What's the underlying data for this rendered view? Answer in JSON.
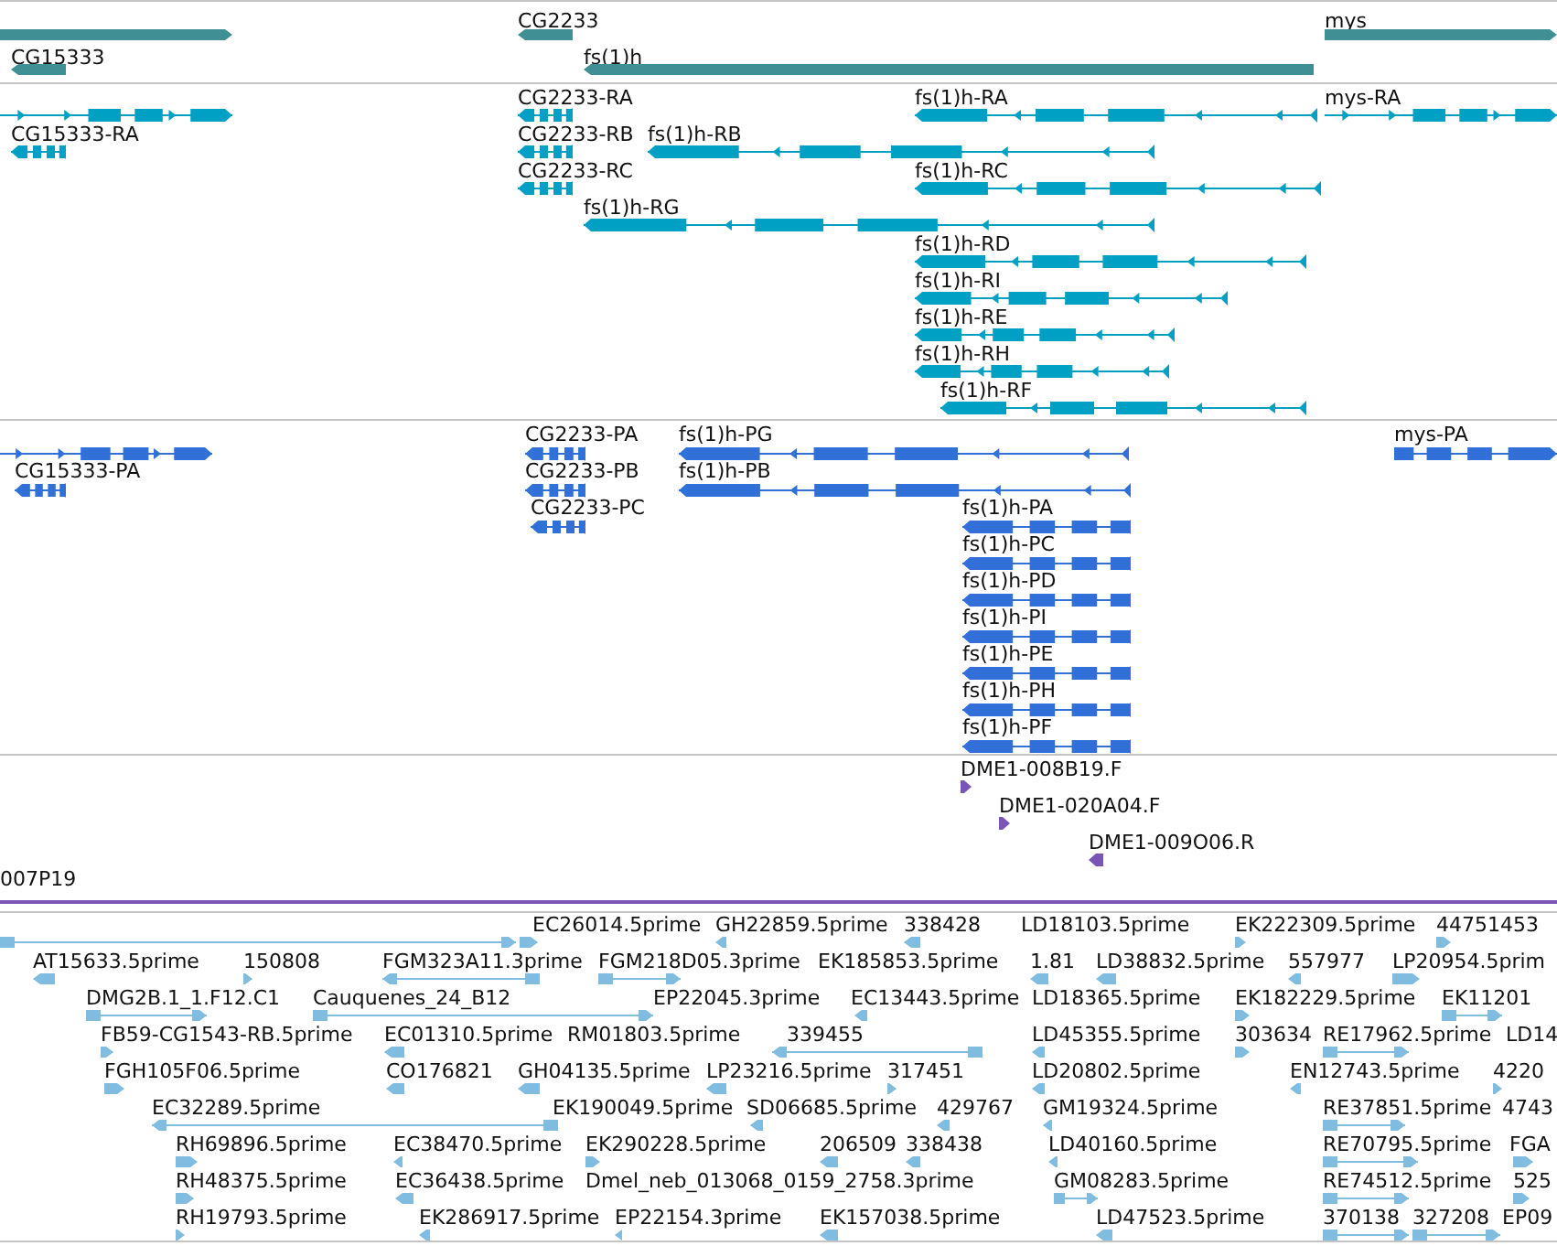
{
  "tracks": [
    {
      "kind": "gene",
      "color": "#3f8f94",
      "features": [
        {
          "reverse": false
        },
        {
          "label": "CG15333",
          "reverse": true
        },
        {
          "label": "CG2233",
          "reverse": true
        },
        {
          "label": "fs(1)h",
          "reverse": true
        },
        {
          "label": "mys",
          "reverse": false
        }
      ]
    },
    {
      "kind": "transcript",
      "color": "#00a0c4",
      "features": [
        {
          "reverse": false
        },
        {
          "label": "CG15333-RA",
          "reverse": true
        },
        {
          "label": "CG2233-RA",
          "reverse": true
        },
        {
          "label": "CG2233-RB",
          "reverse": true
        },
        {
          "label": "fs(1)h-RB",
          "reverse": true
        },
        {
          "label": "CG2233-RC",
          "reverse": true
        },
        {
          "label": "fs(1)h-RG",
          "reverse": true
        },
        {
          "label": "fs(1)h-RA",
          "reverse": true
        },
        {
          "label": "mys-RA",
          "reverse": false
        },
        {
          "label": "fs(1)h-RC",
          "reverse": true
        },
        {
          "label": "fs(1)h-RD",
          "reverse": true
        },
        {
          "label": "fs(1)h-RI",
          "reverse": true
        },
        {
          "label": "fs(1)h-RE",
          "reverse": true
        },
        {
          "label": "fs(1)h-RH",
          "reverse": true
        },
        {
          "label": "fs(1)h-RF",
          "reverse": true
        }
      ]
    },
    {
      "kind": "protein",
      "color": "#3070d8",
      "features": [
        {
          "reverse": false
        },
        {
          "label": "CG15333-PA",
          "reverse": true
        },
        {
          "label": "CG2233-PA",
          "reverse": true
        },
        {
          "label": "CG2233-PB",
          "reverse": true
        },
        {
          "label": "CG2233-PC",
          "reverse": true
        },
        {
          "label": "fs(1)h-PG",
          "reverse": true
        },
        {
          "label": "fs(1)h-PB",
          "reverse": true
        },
        {
          "label": "mys-PA",
          "reverse": false
        },
        {
          "label": "fs(1)h-PA",
          "reverse": true
        },
        {
          "label": "fs(1)h-PC",
          "reverse": true
        },
        {
          "label": "fs(1)h-PD",
          "reverse": true
        },
        {
          "label": "fs(1)h-PI",
          "reverse": true
        },
        {
          "label": "fs(1)h-PE",
          "reverse": true
        },
        {
          "label": "fs(1)h-PH",
          "reverse": true
        },
        {
          "label": "fs(1)h-PF",
          "reverse": true
        }
      ]
    },
    {
      "kind": "clone",
      "color": "#7a55b5",
      "features": [
        {
          "label": "DME1-008B19.F",
          "reverse": false
        },
        {
          "label": "DME1-020A04.F",
          "reverse": false
        },
        {
          "label": "DME1-009O06.R",
          "reverse": true
        },
        {
          "label": "007P19"
        }
      ]
    },
    {
      "kind": "est",
      "color": "#80bce0",
      "features": [
        {
          "reverse": false
        },
        {
          "label": "EC26014.5prime",
          "reverse": false
        },
        {
          "label": "GH22859.5prime",
          "reverse": true
        },
        {
          "label": "338428",
          "reverse": true
        },
        {
          "label": "LD18103.5prime"
        },
        {
          "label": "EK222309.5prime",
          "reverse": false
        },
        {
          "label": "44751453",
          "reverse": false
        },
        {
          "label": "AT15633.5prime",
          "reverse": true
        },
        {
          "label": "150808",
          "reverse": false
        },
        {
          "label": "FGM323A11.3prime",
          "reverse": true
        },
        {
          "label": "FGM218D05.3prime",
          "reverse": false
        },
        {
          "label": "EK185853.5prime"
        },
        {
          "label": "1.81",
          "reverse": true
        },
        {
          "label": "LD38832.5prime",
          "reverse": true
        },
        {
          "label": "557977",
          "reverse": true
        },
        {
          "label": "LP20954.5prim",
          "reverse": false
        },
        {
          "label": "DMG2B.1_1.F12.C1",
          "reverse": false
        },
        {
          "label": "Cauquenes_24_B12",
          "reverse": false
        },
        {
          "label": "EP22045.3prime"
        },
        {
          "label": "EC13443.5prime",
          "reverse": true
        },
        {
          "label": "LD18365.5prime"
        },
        {
          "label": "EK182229.5prime",
          "reverse": false
        },
        {
          "label": "EK11201",
          "reverse": false
        },
        {
          "label": "FB59-CG1543-RB.5prime",
          "reverse": false
        },
        {
          "label": "EC01310.5prime",
          "reverse": true
        },
        {
          "label": "RM01803.5prime"
        },
        {
          "label": "339455",
          "reverse": true
        },
        {
          "label": "LD45355.5prime",
          "reverse": true
        },
        {
          "label": "303634",
          "reverse": false
        },
        {
          "label": "RE17962.5prime",
          "reverse": false
        },
        {
          "label": "LD14"
        },
        {
          "label": "FGH105F06.5prime",
          "reverse": false
        },
        {
          "label": "CO176821",
          "reverse": true
        },
        {
          "label": "GH04135.5prime",
          "reverse": true
        },
        {
          "label": "LP23216.5prime",
          "reverse": true
        },
        {
          "label": "317451",
          "reverse": false
        },
        {
          "label": "LD20802.5prime",
          "reverse": true
        },
        {
          "label": "EN12743.5prime",
          "reverse": true
        },
        {
          "label": "4220",
          "reverse": false
        },
        {
          "label": "EC32289.5prime",
          "reverse": true
        },
        {
          "label": "EK190049.5prime"
        },
        {
          "label": "SD06685.5prime",
          "reverse": true
        },
        {
          "label": "429767",
          "reverse": true
        },
        {
          "label": "GM19324.5prime",
          "reverse": true
        },
        {
          "label": "RE37851.5prime",
          "reverse": false
        },
        {
          "label": "4743"
        },
        {
          "label": "RH69896.5prime",
          "reverse": false
        },
        {
          "label": "EC38470.5prime",
          "reverse": true
        },
        {
          "label": "EK290228.5prime",
          "reverse": false
        },
        {
          "label": "206509",
          "reverse": true
        },
        {
          "label": "338438",
          "reverse": true
        },
        {
          "label": "LD40160.5prime",
          "reverse": true
        },
        {
          "label": "RE70795.5prime",
          "reverse": false
        },
        {
          "label": "FGA",
          "reverse": false
        },
        {
          "label": "RH48375.5prime",
          "reverse": false
        },
        {
          "label": "EC36438.5prime",
          "reverse": true
        },
        {
          "label": "Dmel_neb_013068_0159_2758.3prime"
        },
        {
          "label": "GM08283.5prime",
          "reverse": false
        },
        {
          "label": "RE74512.5prime",
          "reverse": false
        },
        {
          "label": "525",
          "reverse": false
        },
        {
          "label": "RH19793.5prime",
          "reverse": false
        },
        {
          "label": "EK286917.5prime",
          "reverse": true
        },
        {
          "label": "EP22154.3prime",
          "reverse": true
        },
        {
          "label": "EK157038.5prime",
          "reverse": true
        },
        {
          "label": "LD47523.5prime",
          "reverse": true
        },
        {
          "label": "370138",
          "reverse": false
        },
        {
          "label": "327208",
          "reverse": false
        },
        {
          "label": "EP09"
        }
      ]
    }
  ]
}
